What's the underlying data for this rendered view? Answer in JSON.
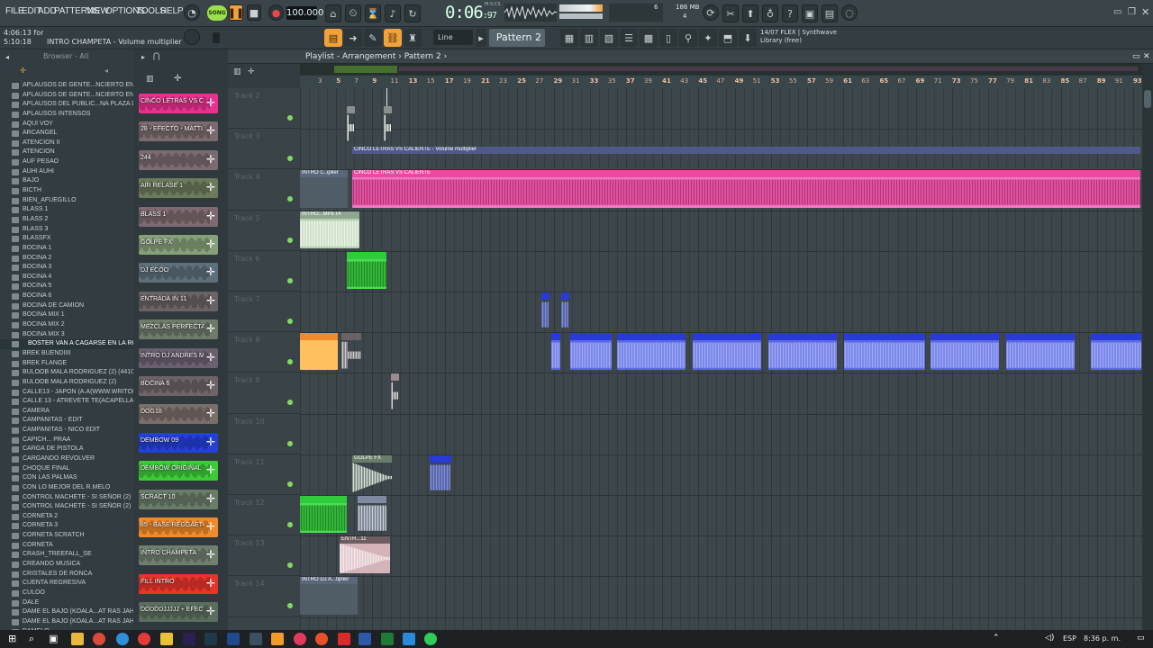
{
  "menu": [
    "FILE",
    "EDIT",
    "ADD",
    "PATTERNS",
    "VIEW",
    "OPTIONS",
    "TOOLS",
    "HELP"
  ],
  "transport": {
    "song_label": "SONG",
    "tempo": "100.000",
    "time": "0:06",
    "time_frac": "97",
    "mics_label": "M:S:CS",
    "memory": "186 MB",
    "cpu": "6",
    "voices": "4"
  },
  "hint": {
    "line1": "4:06:13 for",
    "line2": "5:10:18",
    "message": "INTRO CHAMPETA - Volume multiplier"
  },
  "toolbar": {
    "snap": "Line",
    "pattern": "Pattern 2"
  },
  "flex_info": {
    "line1": "14/07  FLEX | Synthwave",
    "line2": "Library (free)"
  },
  "browser": {
    "title": "Browser - All",
    "items": [
      "APLAUSOS DE GENTE...NCIERTO EN UN PUB 2",
      "APLAUSOS DE GENTE...NCIERTO EN UN PUB 3",
      "APLAUSOS DEL PUBLIC...NA PLAZA DE TOROS",
      "APLAUSOS INTENSOS",
      "AQUI VOY",
      "ARCANGEL",
      "ATENCION II",
      "ATENCION",
      "AUF PESAO",
      "AUHI AUHI",
      "BAJO",
      "BICTH",
      "BIEN_AFUEGILLO",
      "BLASS 1",
      "BLASS 2",
      "BLASS 3",
      "BLASSFX",
      "BOCINA 1",
      "BOCINA 2",
      "BOCINA 3",
      "BOCINA 4",
      "BOCINA 5",
      "BOCINA 6",
      "BOCINA DE CAMION",
      "BOCINA MIX 1",
      "BOCINA MIX 2",
      "BOCINA MIX 3",
      "BOSTER VAN A CAGARSE EN LA ROPA",
      "BREK BUENDIIII",
      "BREK FLANGE",
      "BULOOB MALA RODRIGUEZ (2) (44100 HZ)",
      "BULOOB MALA RODRIGUEZ (2)",
      "CALLE13 - JAPON (A.A(WWW.WRITON.ORG)",
      "CALLE 13 - ATREVETE TE(ACAPELLA)",
      "CAMERA",
      "CAMPANITAS - EDIT",
      "CAMPANITAS - NICO EDIT",
      "CAPICH... PRAA",
      "CARGA DE PISTOLA",
      "CARGANDO REVOLVER",
      "CHOQUE FINAL",
      "CON LAS PALMAS",
      "CON LO MEJOR DEL R.MELO",
      "CONTROL MACHETE - SI SEÑOR (2)",
      "CONTROL MACHETE - SI SEÑOR (2)",
      "CORNETA 2",
      "CORNETA 3",
      "CORNETA SCRATCH",
      "CORNETA",
      "CRASH_TREEFALL_SE",
      "CREANDO MUSICA",
      "CRISTALES DE RONCA",
      "CUENTA REGRESIVA",
      "CULOO",
      "DALE",
      "DAME EL BAJO (KOALA...AT RAS JAHONNAN.1)",
      "DAME EL BAJO (KOALA...AT RAS JAHONNAN.2)",
      "DAMELO"
    ],
    "selected_index": 27
  },
  "channels": [
    {
      "name": "CINCO LETRAS VS CALI...",
      "color": "#e8308e"
    },
    {
      "name": "28 - EFECTO - MATTI...",
      "color": "#7b6a6e"
    },
    {
      "name": "244",
      "color": "#7a6b70"
    },
    {
      "name": "AIR RELASE 1",
      "color": "#6e7a5c"
    },
    {
      "name": "BLASS 1",
      "color": "#7e6a70"
    },
    {
      "name": "GOLPE FX",
      "color": "#86a07a"
    },
    {
      "name": "DJ ECOO",
      "color": "#5d6f7a"
    },
    {
      "name": "ENTRADA IN 11",
      "color": "#6b6266"
    },
    {
      "name": "MEZCLAS PERFECTAS",
      "color": "#6e7a6a"
    },
    {
      "name": "INTRO DJ ANDRES MO...",
      "color": "#6a6070"
    },
    {
      "name": "BOCINA 6",
      "color": "#6e6468"
    },
    {
      "name": "DOG18",
      "color": "#7a6e6a"
    },
    {
      "name": "DEMBOW 09",
      "color": "#2440d8"
    },
    {
      "name": "DEMBOW ORIGINAL (4...",
      "color": "#3ecb3a"
    },
    {
      "name": "SCRACT 10",
      "color": "#6a7d6a"
    },
    {
      "name": "85 - BASE REGGAETO...",
      "color": "#f08a2a"
    },
    {
      "name": "INTRO CHAMPETA",
      "color": "#6f7f70"
    },
    {
      "name": "FILL INTRO",
      "color": "#e8352a"
    },
    {
      "name": "DDDDDJJJJJ + EFECT",
      "color": "#5c6e60"
    }
  ],
  "playlist": {
    "title": "Playlist - Arrangement",
    "pattern": "Pattern 2",
    "bars": [
      "5",
      "9",
      "13",
      "17",
      "21",
      "25",
      "29",
      "33",
      "37",
      "41",
      "45",
      "49",
      "53",
      "57",
      "61",
      "65",
      "69",
      "73",
      "77",
      "81",
      "85",
      "89",
      "93"
    ],
    "bars_small": [
      "3",
      "7",
      "11",
      "15",
      "19",
      "23",
      "27",
      "31",
      "35",
      "39",
      "43",
      "47",
      "51",
      "55",
      "59",
      "63",
      "67",
      "71",
      "75",
      "79",
      "83",
      "87",
      "91"
    ],
    "tracks": [
      "Track 2",
      "Track 3",
      "Track 4",
      "Track 5",
      "Track 6",
      "Track 7",
      "Track 8",
      "Track 9",
      "Track 10",
      "Track 11",
      "Track 12",
      "Track 13",
      "Track 14"
    ],
    "clip_labels": {
      "automation_t3": "CINCO LETRAS VS CALIENTE - Volume multiplier",
      "intro_auto": "INTRO C..iplier",
      "cinco": "CINCO LETRAS VS CALIENTE",
      "intro_mpeta": "INTRO...MPETA",
      "golpe": "GOLPE FX",
      "entr": "ENTR...11",
      "intro_dj": "INTRO DJ A...tiplier"
    }
  },
  "taskbar": {
    "lang": "ESP",
    "time": "8:36 p. m."
  }
}
